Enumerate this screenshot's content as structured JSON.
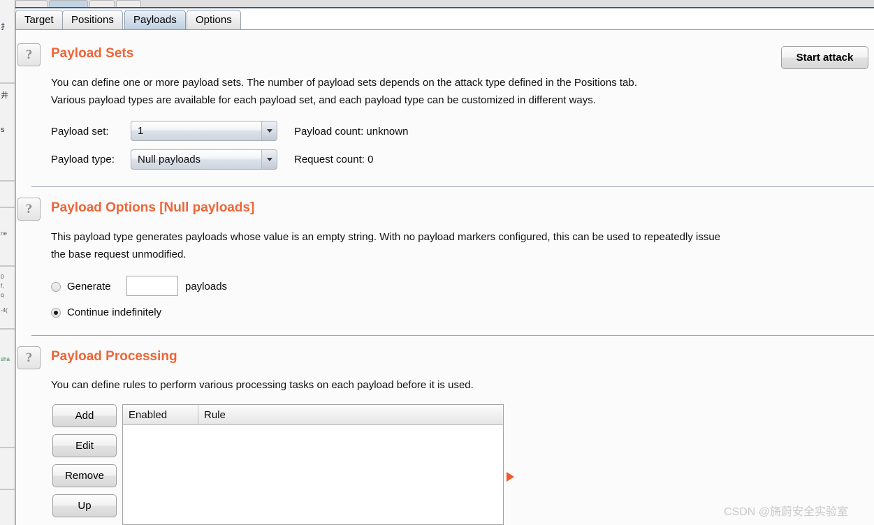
{
  "window": {
    "tabs": [
      {
        "label": "Target",
        "selected": false
      },
      {
        "label": "Positions",
        "selected": false
      },
      {
        "label": "Payloads",
        "selected": true
      },
      {
        "label": "Options",
        "selected": false
      }
    ]
  },
  "toolbar": {
    "start_attack_label": "Start attack"
  },
  "help_icon_label": "?",
  "sections": {
    "payload_sets": {
      "title": "Payload Sets",
      "description_line1": "You can define one or more payload sets. The number of payload sets depends on the attack type defined in the Positions tab.",
      "description_line2": "Various payload types are available for each payload set, and each payload type can be customized in different ways.",
      "payload_set_label": "Payload set:",
      "payload_set_value": "1",
      "payload_type_label": "Payload type:",
      "payload_type_value": "Null payloads",
      "payload_count_label": "Payload count:  unknown",
      "request_count_label": "Request count: 0"
    },
    "payload_options": {
      "title": "Payload Options [Null payloads]",
      "description_line1": "This payload type generates payloads whose value is an empty string. With no payload markers configured, this can be used to repeatedly issue",
      "description_line2": "the base request unmodified.",
      "generate_label": "Generate",
      "generate_value": "",
      "generate_placeholder": "",
      "generate_suffix": "payloads",
      "continue_label": "Continue indefinitely",
      "selected_option": "continue"
    },
    "payload_processing": {
      "title": "Payload Processing",
      "description_line1": "You can define rules to perform various processing tasks on each payload before it is used.",
      "buttons": [
        {
          "label": "Add"
        },
        {
          "label": "Edit"
        },
        {
          "label": "Remove"
        },
        {
          "label": "Up"
        }
      ],
      "table": {
        "columns": [
          "Enabled",
          "Rule"
        ],
        "rows": []
      }
    }
  },
  "colors": {
    "accent_orange": "#ec6639",
    "marker_orange": "#f05a28",
    "selected_tab": "#c2d4e4"
  },
  "watermark": "CSDN @旖蔚安全实验室"
}
